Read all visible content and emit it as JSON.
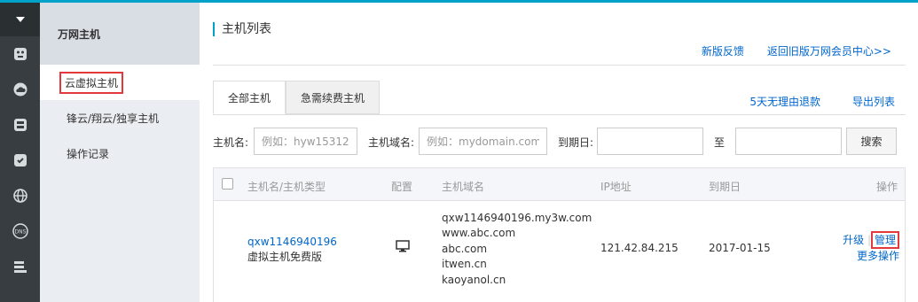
{
  "iconbar": {
    "items": [
      "menu-toggle",
      "hosting-icon",
      "cloud-icon",
      "server-icon",
      "security-icon",
      "globe-icon",
      "dns-icon",
      "storage-icon"
    ]
  },
  "subnav": {
    "title": "万网主机",
    "items": [
      {
        "label": "云虚拟主机",
        "active": true
      },
      {
        "label": "锋云/翔云/独享主机",
        "active": false
      },
      {
        "label": "操作记录",
        "active": false
      }
    ]
  },
  "header": {
    "title": "主机列表",
    "links": {
      "feedback": "新版反馈",
      "old_version": "返回旧版万网会员中心>>"
    }
  },
  "tabs": [
    {
      "label": "全部主机",
      "active": true
    },
    {
      "label": "急需续费主机",
      "active": false
    }
  ],
  "tab_links": {
    "refund": "5天无理由退款",
    "export": "导出列表"
  },
  "search": {
    "host_label": "主机名:",
    "host_placeholder": "例如：hyw15312",
    "domain_label": "主机域名:",
    "domain_placeholder": "例如：mydomain.com",
    "expiry_label": "到期日:",
    "to_label": "至",
    "button": "搜索"
  },
  "table": {
    "headers": {
      "name": "主机名/主机类型",
      "config": "配置",
      "domain": "主机域名",
      "ip": "IP地址",
      "expiry": "到期日",
      "action": "操作"
    },
    "rows": [
      {
        "name": "qxw1146940196",
        "type": "虚拟主机免费版",
        "config_icon": "monitor-icon",
        "domains": [
          "qxw1146940196.my3w.com",
          "www.abc.com",
          "abc.com",
          "itwen.cn",
          "kaoyanol.cn"
        ],
        "ip": "121.42.84.215",
        "expiry": "2017-01-15",
        "actions": {
          "upgrade": "升级",
          "manage": "管理",
          "more": "更多操作"
        }
      }
    ]
  },
  "colors": {
    "accent": "#00a2ca",
    "link": "#0066cc",
    "highlight": "#e4393c",
    "sidebar_dark": "#373d41",
    "subnav_bg": "#eaedf1"
  }
}
